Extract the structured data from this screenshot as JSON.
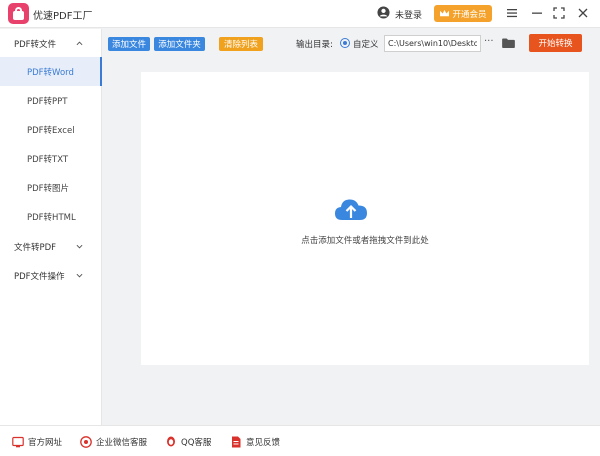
{
  "app": {
    "title": "优速PDF工厂"
  },
  "header": {
    "login_label": "未登录",
    "vip_label": "开通会员",
    "colors": {
      "vip": "#f4a22b",
      "brand": "#e8416c"
    },
    "icons": [
      "user-icon",
      "crown-icon",
      "menu-icon",
      "minimize-icon",
      "maximize-icon",
      "close-icon"
    ]
  },
  "sidebar": {
    "groups": [
      {
        "label": "PDF转文件",
        "expanded": true,
        "items": [
          {
            "label": "PDF转Word",
            "active": true
          },
          {
            "label": "PDF转PPT"
          },
          {
            "label": "PDF转Excel"
          },
          {
            "label": "PDF转TXT"
          },
          {
            "label": "PDF转图片"
          },
          {
            "label": "PDF转HTML"
          }
        ]
      },
      {
        "label": "文件转PDF",
        "expanded": false
      },
      {
        "label": "PDF文件操作",
        "expanded": false
      }
    ]
  },
  "toolbar": {
    "add_file": "添加文件",
    "add_folder": "添加文件夹",
    "clear_list": "清除列表",
    "output_label": "输出目录:",
    "custom_option": "自定义",
    "output_path": "C:\\Users\\win10\\Desktop",
    "more": "···",
    "start": "开始转换",
    "colors": {
      "primary": "#3a87e0",
      "warning": "#f0a11e",
      "start": "#e8541e"
    }
  },
  "drop_area": {
    "hint": "点击添加文件或者拖拽文件到此处",
    "icon": "cloud-upload-icon"
  },
  "footer": {
    "links": [
      {
        "label": "官方网址",
        "icon": "website-icon"
      },
      {
        "label": "企业微信客服",
        "icon": "wechat-service-icon"
      },
      {
        "label": "QQ客服",
        "icon": "qq-icon"
      },
      {
        "label": "意见反馈",
        "icon": "feedback-icon"
      }
    ]
  }
}
